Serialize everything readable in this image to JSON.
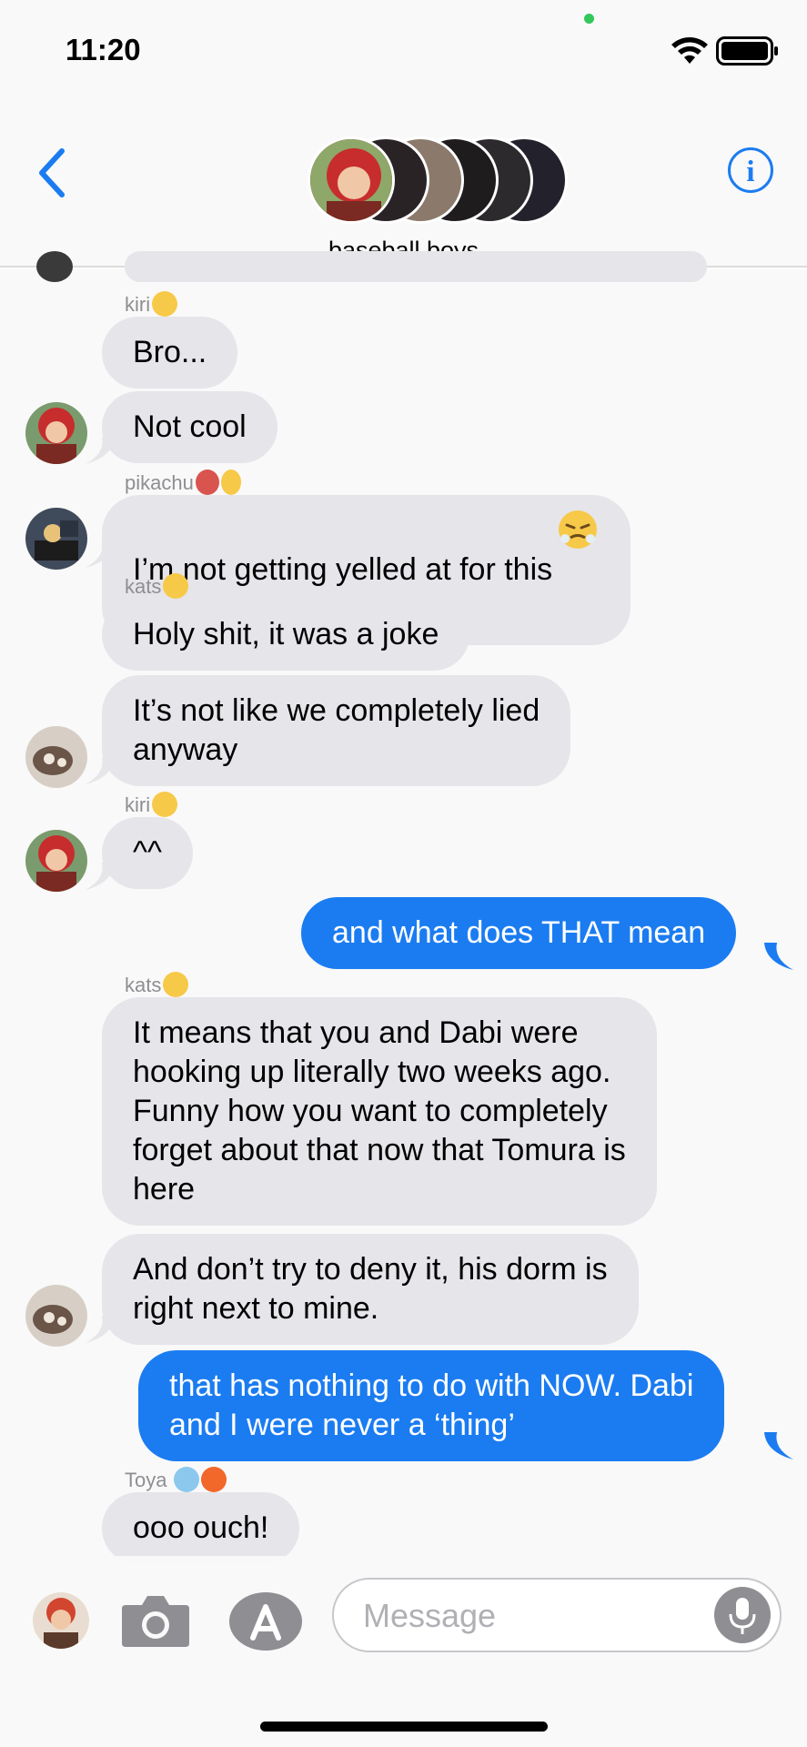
{
  "status_bar": {
    "time": "11:20"
  },
  "header": {
    "group_name": "baseball boys",
    "back_icon": "chevron-left-icon",
    "info_icon": "info-circle-icon",
    "info_glyph": "i"
  },
  "messages": [
    {
      "sender": "kiri",
      "text": "Bro..."
    },
    {
      "text": "Not cool"
    },
    {
      "sender": "pikachu",
      "text": "I’m not getting yelled at for this"
    },
    {
      "sender": "kats",
      "text": "Holy shit, it was a joke"
    },
    {
      "text": "It’s not like we completely lied\nanyway"
    },
    {
      "sender": "kiri",
      "text": "^^"
    },
    {
      "text": "and what does THAT mean"
    },
    {
      "sender": "kats",
      "text": "It means that you and Dabi were\nhooking up literally two weeks ago.\nFunny how you want to completely\nforget about that now that Tomura is\nhere"
    },
    {
      "text": "And don’t try to deny it, his dorm is\nright next to mine."
    },
    {
      "text": "that has nothing to do with NOW. Dabi\nand I were never a ‘thing’"
    },
    {
      "sender": "Toya",
      "text": "ooo ouch!"
    }
  ],
  "input": {
    "placeholder": "Message",
    "camera_icon": "camera-icon",
    "apps_icon": "app-store-icon",
    "mic_icon": "microphone-icon"
  },
  "colors": {
    "outgoing": "#1b7cf1",
    "incoming": "#e5e5ea",
    "accent": "#1b7cf1"
  }
}
